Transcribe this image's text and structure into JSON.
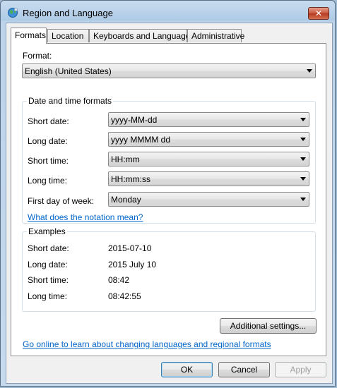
{
  "window": {
    "title": "Region and Language",
    "close_glyph": "✕"
  },
  "tabs": [
    {
      "label": "Formats",
      "active": true
    },
    {
      "label": "Location"
    },
    {
      "label": "Keyboards and Languages"
    },
    {
      "label": "Administrative"
    }
  ],
  "format": {
    "label": "Format:",
    "value": "English (United States)"
  },
  "date_time": {
    "title": "Date and time formats",
    "short_date": {
      "label": "Short date:",
      "value": "yyyy-MM-dd"
    },
    "long_date": {
      "label": "Long date:",
      "value": "yyyy MMMM dd"
    },
    "short_time": {
      "label": "Short time:",
      "value": "HH:mm"
    },
    "long_time": {
      "label": "Long time:",
      "value": "HH:mm:ss"
    },
    "first_day": {
      "label": "First day of week:",
      "value": "Monday"
    },
    "notation_link": "What does the notation mean?"
  },
  "examples": {
    "title": "Examples",
    "short_date": {
      "label": "Short date:",
      "value": "2015-07-10"
    },
    "long_date": {
      "label": "Long date:",
      "value": "2015 July 10"
    },
    "short_time": {
      "label": "Short time:",
      "value": "08:42"
    },
    "long_time": {
      "label": "Long time:",
      "value": "08:42:55"
    }
  },
  "additional_settings": "Additional settings...",
  "online_link": "Go online to learn about changing languages and regional formats",
  "buttons": {
    "ok": "OK",
    "cancel": "Cancel",
    "apply": "Apply"
  }
}
